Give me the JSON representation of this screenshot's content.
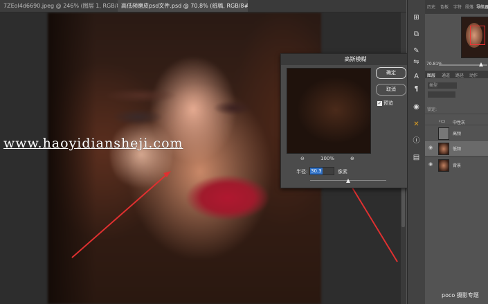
{
  "tabs": [
    {
      "label": "7ZEol4d6690.jpeg @ 246% (图层 1, RGB/8#) *"
    },
    {
      "label": "高低频磨皮psd文件.psd @ 70.8% (纸稿, RGB/8#) *"
    }
  ],
  "watermark": "www.haoyidiansheji.com",
  "panel": {
    "tabs": [
      "历史",
      "色板",
      "字符",
      "段落",
      "导航器"
    ],
    "zoom": "70.81%",
    "layer_tabs": [
      "图层",
      "通道",
      "路径",
      "动作"
    ],
    "kind_label": "类型",
    "lock_label": "锁定:",
    "layers": [
      {
        "name": "中性灰",
        "visible": false
      },
      {
        "name": "高频",
        "visible": false
      },
      {
        "name": "低频",
        "visible": true,
        "selected": true
      },
      {
        "name": "背景",
        "visible": true
      }
    ]
  },
  "dialog": {
    "title": "高斯模糊",
    "ok_label": "确定",
    "cancel_label": "取消",
    "preview_label": "预览",
    "preview_checked": true,
    "zoom": "100%",
    "radius_label": "半径:",
    "radius_value": "30.3",
    "radius_unit": "像素",
    "radius_slider_fraction": 0.5
  },
  "footer": {
    "logo": "poco 摄影专题"
  },
  "colors": {
    "selection": "#2e6fc4",
    "arrow": "#e03030",
    "lips": "#b01830"
  }
}
